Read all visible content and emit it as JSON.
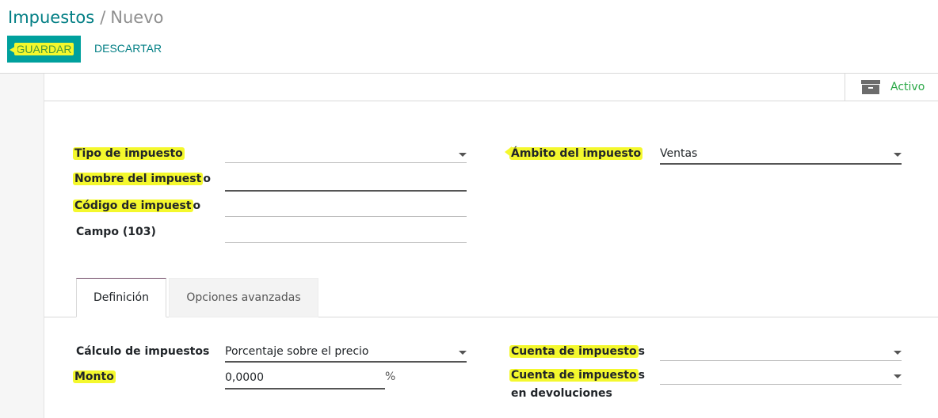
{
  "breadcrumb": {
    "parent": "Impuestos",
    "separator": "/",
    "current": "Nuevo"
  },
  "toolbar": {
    "save_label": "GUARDAR",
    "discard_label": "DESCARTAR"
  },
  "status": {
    "active_label": "Activo",
    "icon": "archive-icon"
  },
  "form": {
    "tax_type": {
      "label": "Tipo de impuesto",
      "value": ""
    },
    "tax_name": {
      "label_hl": "Nombre del impuest",
      "label_rest": "o",
      "value": ""
    },
    "tax_code": {
      "label_hl": "Código de impuest",
      "label_rest": "o",
      "value": ""
    },
    "field_103": {
      "label": "Campo (103)",
      "value": ""
    },
    "tax_scope": {
      "label": "Ámbito del impuesto",
      "value": "Ventas"
    }
  },
  "tabs": [
    {
      "label": "Definición",
      "active": true
    },
    {
      "label": "Opciones avanzadas",
      "active": false
    }
  ],
  "definition": {
    "computation": {
      "label": "Cálculo de impuestos",
      "value": "Porcentaje sobre el precio"
    },
    "amount": {
      "label": "Monto",
      "value": "0,0000",
      "unit": "%"
    },
    "tax_account": {
      "label_hl": "Cuenta de impuesto",
      "label_rest": "s",
      "value": ""
    },
    "refund_account": {
      "label_hl": "Cuenta de impuesto",
      "label_rest": "s",
      "label_line2": "en devoluciones",
      "value": ""
    }
  },
  "colors": {
    "brand": "#00a09d",
    "link": "#017e84",
    "highlight": "#f4f82d",
    "active_text": "#28a745"
  }
}
